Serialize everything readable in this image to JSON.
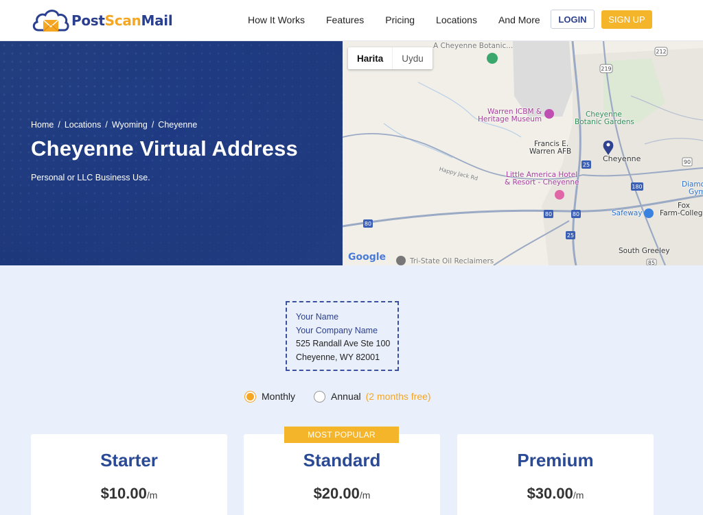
{
  "header": {
    "logo": {
      "part1": "Post",
      "part2": "Scan",
      "part3": "Mail"
    },
    "nav": [
      "How It Works",
      "Features",
      "Pricing",
      "Locations",
      "And More"
    ],
    "login_label": "LOGIN",
    "signup_label": "SIGN UP"
  },
  "hero": {
    "breadcrumb": [
      "Home",
      "Locations",
      "Wyoming",
      "Cheyenne"
    ],
    "breadcrumb_sep": "/",
    "title": "Cheyenne Virtual Address",
    "subtitle": "Personal or LLC Business Use."
  },
  "map": {
    "toggle": {
      "map_label": "Harita",
      "satellite_label": "Uydu"
    },
    "labels": {
      "botanic_top": "A Cheyenne Botanic...",
      "warren_museum_1": "Warren ICBM &",
      "warren_museum_2": "Heritage Museum",
      "cheyenne_botanic_1": "Cheyenne",
      "cheyenne_botanic_2": "Botanic Gardens",
      "warren_afb_1": "Francis E.",
      "warren_afb_2": "Warren AFB",
      "city": "Cheyenne",
      "happy_jack": "Happy Jack Rd",
      "little_america_1": "Little America Hotel",
      "little_america_2": "& Resort - Cheyenne",
      "diamond_1": "Diamo",
      "diamond_2": "Gym",
      "fox_1": "Fox",
      "fox_2": "Farm-Colleg",
      "safeway": "Safeway",
      "south_greeley": "South Greeley",
      "tri_state": "Tri-State Oil Reclaimers",
      "google": "Google"
    },
    "shields": [
      "212",
      "219",
      "25",
      "90",
      "180",
      "80",
      "80",
      "80",
      "85",
      "25"
    ]
  },
  "address_card": {
    "line1": "Your Name",
    "line2": "Your Company Name",
    "line3": "525 Randall Ave Ste 100",
    "line4": "Cheyenne, WY 82001"
  },
  "billing": {
    "monthly_label": "Monthly",
    "annual_label": "Annual",
    "annual_note": "(2 months free)",
    "selected": "monthly"
  },
  "plans": {
    "badge": "MOST POPULAR",
    "items": [
      {
        "name": "Starter",
        "price": "$10.00",
        "per": "/m"
      },
      {
        "name": "Standard",
        "price": "$20.00",
        "per": "/m"
      },
      {
        "name": "Premium",
        "price": "$30.00",
        "per": "/m"
      }
    ]
  },
  "colors": {
    "brand_blue": "#2b3f8f",
    "accent_orange": "#f5a623",
    "hero_bg": "#243f7e",
    "page_bg": "#e9effb"
  }
}
